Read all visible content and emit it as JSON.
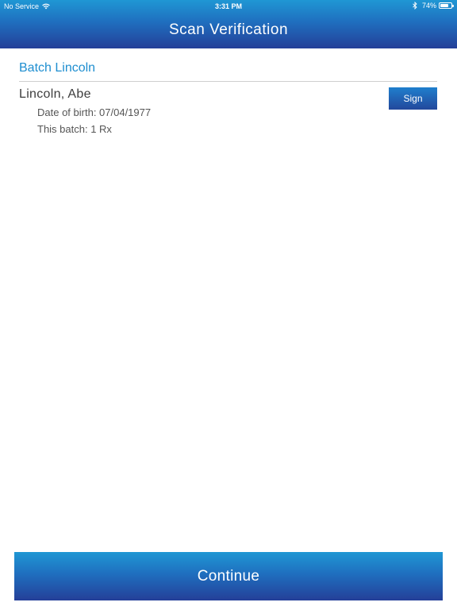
{
  "status_bar": {
    "carrier": "No Service",
    "time": "3:31 PM",
    "battery_percent": "74%",
    "battery_level": 0.74,
    "icons": [
      "wifi-icon",
      "bluetooth-icon",
      "battery-icon"
    ]
  },
  "header": {
    "title": "Scan Verification"
  },
  "batch": {
    "title": "Batch Lincoln"
  },
  "patient": {
    "name": "Lincoln, Abe",
    "dob": "Date of birth: 07/04/1977",
    "batch_count": "This batch: 1 Rx",
    "sign_label": "Sign"
  },
  "footer": {
    "continue_label": "Continue"
  },
  "colors": {
    "accent": "#1e8ed0",
    "header_top": "#1f97d4",
    "header_bottom": "#243f98"
  }
}
